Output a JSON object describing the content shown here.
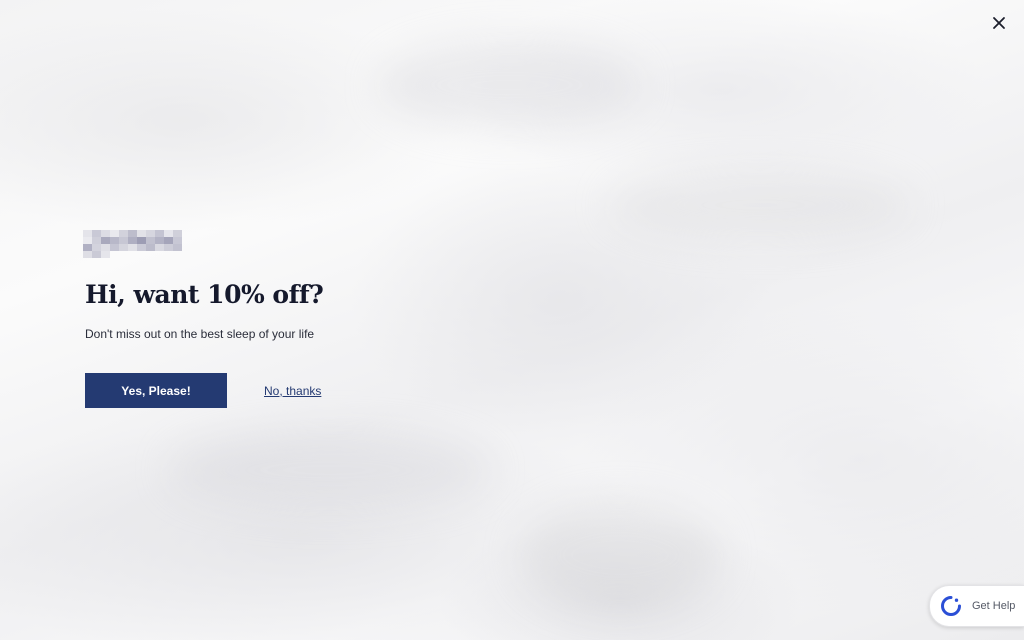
{
  "page": {
    "background_description_color": "#f4f4f5"
  },
  "close": {
    "icon": "close-icon"
  },
  "popup": {
    "logo_icon": "brand-logo-pixelated",
    "headline": "Hi, want 10% off?",
    "subtext": "Don't miss out on the best sleep of your life",
    "yes_label": "Yes, Please!",
    "no_label": "No, thanks"
  },
  "help_widget": {
    "icon": "help-spinner-icon",
    "label": "Get Help"
  },
  "colors": {
    "primary": "#243a72",
    "text_dark": "#15192c",
    "help_icon": "#2b4fd6"
  }
}
